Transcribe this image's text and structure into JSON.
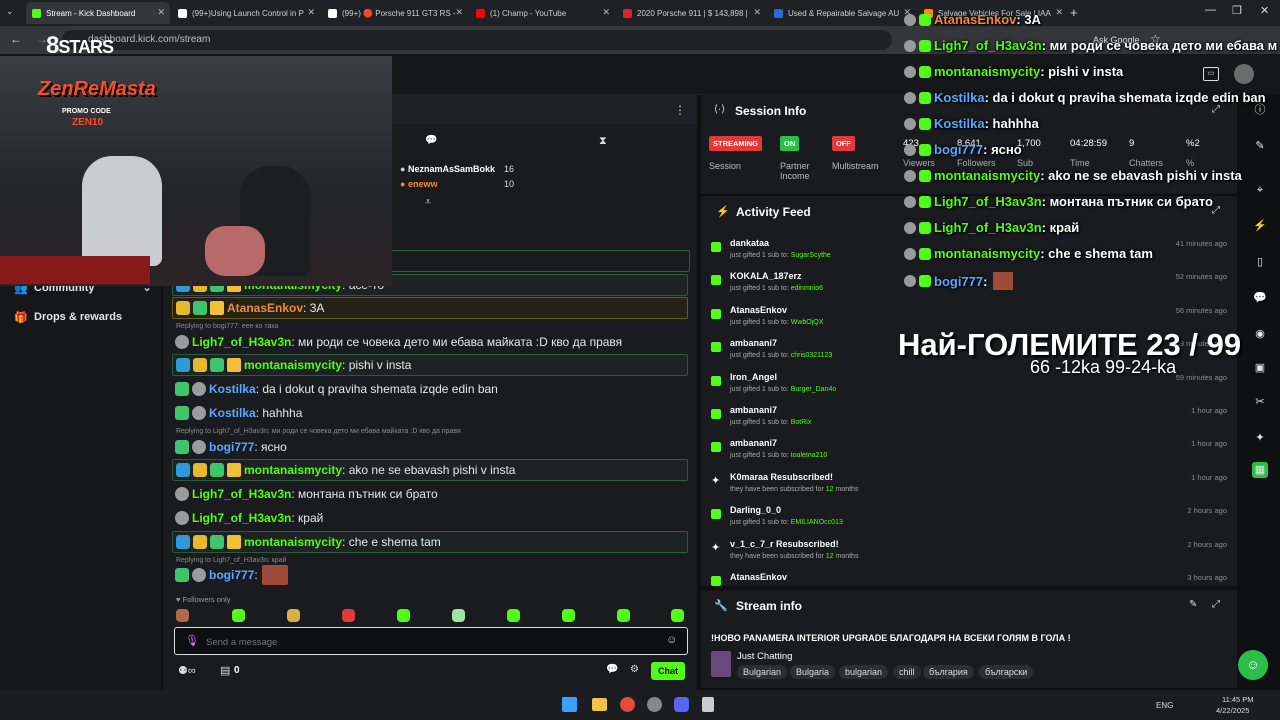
{
  "browser": {
    "tabs": [
      {
        "label": "Stream - Kick Dashboard",
        "color": "#53fc18",
        "active": true
      },
      {
        "label": "(99+)Using Launch Control in P",
        "color": "#ffffff"
      },
      {
        "label": "(99+) 🔴 Porsche 911 GT3 RS -",
        "color": "#ffffff"
      },
      {
        "label": "(1) Champ - YouTube",
        "color": "#ff0000"
      },
      {
        "label": "2020 Porsche 911 | $ 143,898 |",
        "color": "#d6252b"
      },
      {
        "label": "Used & Repairable Salvage AU",
        "color": "#2a6ad6"
      },
      {
        "label": "Salvage Vehicles For Sale | IAA",
        "color": "#ff8c00"
      }
    ],
    "url": "dashboard.kick.com/stream",
    "ask_google": "Ask Google"
  },
  "sidebar": {
    "community": "Community",
    "drops": "Drops & rewards"
  },
  "webcam_overlay": {
    "logo_top": "STARS",
    "brand": "ZenReMasta",
    "promo_label": "PROMO CODE",
    "promo_code": "ZEN10"
  },
  "chat": {
    "top_users": [
      {
        "name": "NeznamAsSamBokk",
        "count": "16"
      },
      {
        "name": "eneww",
        "count": "10"
      }
    ],
    "messages": [
      {
        "user": "montanaismycity",
        "user_color": "#53fc18",
        "text": ": асе-то",
        "style": "hl"
      },
      {
        "user": "AtanasEnkov",
        "user_color": "#f08a3a",
        "text": ": 3A",
        "style": "hl-gold"
      },
      {
        "reply": "Replying to bogi777: еее ко така"
      },
      {
        "user": "Ligh7_of_H3av3n",
        "user_color": "#53fc18",
        "text": ": ми роди се човека дето ми ебава майката :D кво да правя",
        "style": ""
      },
      {
        "user": "montanaismycity",
        "user_color": "#53fc18",
        "text": ": pishi v insta",
        "style": "hl"
      },
      {
        "user": "Kostilka",
        "user_color": "#5aa8ff",
        "text": ": da i dokut q praviha shemata izqde edin ban",
        "style": ""
      },
      {
        "user": "Kostilka",
        "user_color": "#5aa8ff",
        "text": ": hahhha",
        "style": ""
      },
      {
        "reply": "Replying to Ligh7_of_H3av3n: ми роди се човека дето ми ебава майката :D кво да правя"
      },
      {
        "user": "bogi777",
        "user_color": "#5aa8ff",
        "text": ": ясно",
        "style": ""
      },
      {
        "user": "montanaismycity",
        "user_color": "#53fc18",
        "text": ": ako ne se ebavash pishi v insta",
        "style": "hl"
      },
      {
        "user": "Ligh7_of_H3av3n",
        "user_color": "#53fc18",
        "text": ": монтана пътник си брато",
        "style": ""
      },
      {
        "user": "Ligh7_of_H3av3n",
        "user_color": "#53fc18",
        "text": ": край",
        "style": ""
      },
      {
        "user": "montanaismycity",
        "user_color": "#53fc18",
        "text": ": che e shema tam",
        "style": "hl"
      },
      {
        "reply": "Replying to Ligh7_of_H3av3n: край"
      },
      {
        "user": "bogi777",
        "user_color": "#5aa8ff",
        "text": ":",
        "style": ""
      }
    ],
    "followers_only": "Followers only",
    "input_placeholder": "Send a message",
    "points_count": "0",
    "send_label": "Chat"
  },
  "session": {
    "title": "Session Info",
    "items": [
      {
        "badge": "STREAMING",
        "badge_color": "#e03a3a",
        "label": "Session"
      },
      {
        "badge": "ON",
        "badge_color": "#2bbf4a",
        "label": "Partner Income"
      },
      {
        "badge": "OFF",
        "badge_color": "#e03a3a",
        "label": "Multistream"
      }
    ],
    "stats": [
      {
        "value": "423",
        "label": "Viewers"
      },
      {
        "value": "8,641",
        "label": "Followers"
      },
      {
        "value": "1,700",
        "label": "Sub"
      },
      {
        "value": "04:28:59",
        "label": "Time"
      },
      {
        "value": "9",
        "label": "Chatters"
      },
      {
        "value": "%2",
        "label": "%"
      }
    ]
  },
  "activity": {
    "title": "Activity Feed",
    "items": [
      {
        "name": "dankataa",
        "sub": "just gifted 1 sub to:",
        "target": "SugarScythe",
        "time": "41 minutes ago",
        "kind": "gift"
      },
      {
        "name": "KOKALA_187erz",
        "sub": "just gifted 1 sub to:",
        "target": "edinmnio6",
        "time": "52 minutes ago",
        "kind": "gift"
      },
      {
        "name": "AtanasEnkov",
        "sub": "just gifted 1 sub to:",
        "target": "WwbOjQX",
        "time": "56 minutes ago",
        "kind": "gift"
      },
      {
        "name": "ambanani7",
        "sub": "just gifted 1 sub to:",
        "target": "chris0321123",
        "time": "59 minutes ago",
        "kind": "gift"
      },
      {
        "name": "Iron_Angel",
        "sub": "just gifted 1 sub to:",
        "target": "Burger_Dan4o",
        "time": "59 minutes ago",
        "kind": "gift"
      },
      {
        "name": "ambanani7",
        "sub": "just gifted 1 sub to:",
        "target": "BotRix",
        "time": "1 hour ago",
        "kind": "gift"
      },
      {
        "name": "ambanani7",
        "sub": "just gifted 1 sub to:",
        "target": "toaletna210",
        "time": "1 hour ago",
        "kind": "gift"
      },
      {
        "name": "K0maraa Resubscribed!",
        "sub": "they have been subscribed for",
        "target": "12",
        "suffix": "months",
        "time": "1 hour ago",
        "kind": "resub"
      },
      {
        "name": "Darling_0_0",
        "sub": "just gifted 1 sub to:",
        "target": "EMILIANOcc013",
        "time": "2 hours ago",
        "kind": "gift"
      },
      {
        "name": "v_1_c_7_r Resubscribed!",
        "sub": "they have been subscribed for",
        "target": "12",
        "suffix": "months",
        "time": "2 hours ago",
        "kind": "resub"
      },
      {
        "name": "AtanasEnkov",
        "sub": "",
        "target": "",
        "time": "3 hours ago",
        "kind": "gift"
      }
    ]
  },
  "stream_info": {
    "title": "Stream info",
    "stream_title": "!НОВО PANAMERA INTERIOR UPGRADE БЛАГОДАРЯ НА ВСЕКИ ГОЛЯМ В ГОЛА !",
    "category": "Just Chatting",
    "tags": [
      "Bulgarian",
      "Bulgaria",
      "bulgarian",
      "chill",
      "българия",
      "български"
    ]
  },
  "overlay": {
    "chat": [
      {
        "user": "AtanasEnkov",
        "text": ": 3A",
        "color": "#f08a3a"
      },
      {
        "user": "Ligh7_of_H3av3n",
        "text": ": ми роди се човека дето ми ебава м",
        "color": "#53fc18"
      },
      {
        "user": "montanaismycity",
        "text": ": pishi v insta",
        "color": "#53fc18"
      },
      {
        "user": "Kostilka",
        "text": ": da i dokut q praviha shemata izqde edin ban",
        "color": "#5aa8ff"
      },
      {
        "user": "Kostilka",
        "text": ": hahhha",
        "color": "#5aa8ff"
      },
      {
        "user": "bogi777",
        "text": ": ясно",
        "color": "#5aa8ff"
      },
      {
        "user": "montanaismycity",
        "text": ": ako ne se ebavash pishi v insta",
        "color": "#53fc18"
      },
      {
        "user": "Ligh7_of_H3av3n",
        "text": ": монтана пътник си брато",
        "color": "#53fc18"
      },
      {
        "user": "Ligh7_of_H3av3n",
        "text": ": край",
        "color": "#53fc18"
      },
      {
        "user": "montanaismycity",
        "text": ": che e shema tam",
        "color": "#53fc18"
      },
      {
        "user": "bogi777",
        "text": ":",
        "color": "#5aa8ff"
      }
    ],
    "goal_title": "Най-ГОЛЕМИТЕ 23 / 99",
    "goal_sub": "66 -12ka 99-24-ka"
  },
  "taskbar": {
    "lang": "ENG",
    "time": "11:45 PM",
    "date": "4/22/2025"
  }
}
